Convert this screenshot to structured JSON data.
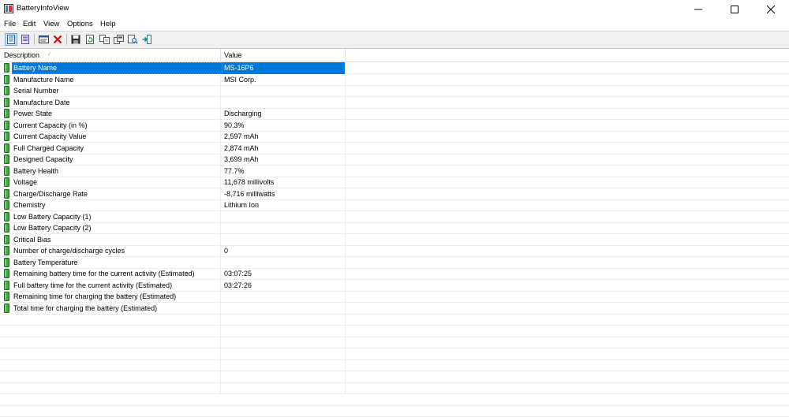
{
  "window": {
    "title": "BatteryInfoView"
  },
  "menu": [
    "File",
    "Edit",
    "View",
    "Options",
    "Help"
  ],
  "toolbar": {
    "buttons": [
      {
        "name": "view-text-icon"
      },
      {
        "name": "view-list-icon"
      },
      {
        "name": "properties-icon"
      },
      {
        "name": "delete-icon"
      },
      {
        "name": "save-icon"
      },
      {
        "name": "refresh-icon"
      },
      {
        "name": "copy-icon"
      },
      {
        "name": "html-report-icon"
      },
      {
        "name": "find-icon"
      },
      {
        "name": "exit-icon"
      }
    ]
  },
  "columns": {
    "description": "Description",
    "value": "Value"
  },
  "rows": [
    {
      "description": "Battery Name",
      "value": "MS-16P6"
    },
    {
      "description": "Manufacture Name",
      "value": "MSI Corp."
    },
    {
      "description": "Serial Number",
      "value": ""
    },
    {
      "description": "Manufacture Date",
      "value": ""
    },
    {
      "description": "Power State",
      "value": "Discharging"
    },
    {
      "description": "Current Capacity (in %)",
      "value": "90.3%"
    },
    {
      "description": "Current Capacity Value",
      "value": "2,597 mAh"
    },
    {
      "description": "Full Charged Capacity",
      "value": "2,874 mAh"
    },
    {
      "description": "Designed Capacity",
      "value": "3,699 mAh"
    },
    {
      "description": "Battery Health",
      "value": "77.7%"
    },
    {
      "description": "Voltage",
      "value": "11,678 millivolts"
    },
    {
      "description": "Charge/Discharge Rate",
      "value": "-8,716 milliwatts"
    },
    {
      "description": "Chemistry",
      "value": "Lithium Ion"
    },
    {
      "description": "Low Battery Capacity (1)",
      "value": ""
    },
    {
      "description": "Low Battery Capacity (2)",
      "value": ""
    },
    {
      "description": "Critical Bias",
      "value": ""
    },
    {
      "description": "Number of charge/discharge cycles",
      "value": "0"
    },
    {
      "description": "Battery Temperature",
      "value": ""
    },
    {
      "description": "Remaining battery time for the current activity (Estimated)",
      "value": "03:07:25"
    },
    {
      "description": "Full battery time for the current activity (Estimated)",
      "value": "03:27:26"
    },
    {
      "description": "Remaining time for charging the battery (Estimated)",
      "value": ""
    },
    {
      "description": "Total  time for charging the battery (Estimated)",
      "value": ""
    }
  ],
  "selected_row": 0,
  "colors": {
    "selection": "#0078d7",
    "battery_icon": "#3aa83a"
  }
}
